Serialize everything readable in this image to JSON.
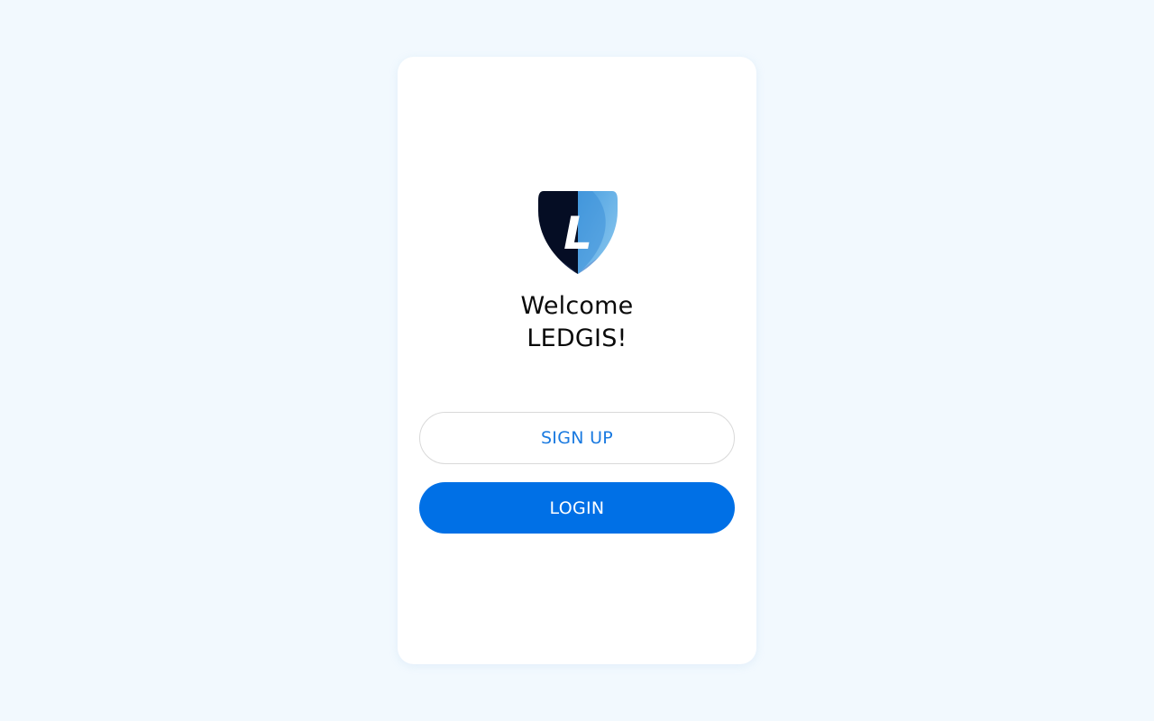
{
  "app": {
    "logo_icon": "shield-l-logo-icon",
    "logo_letter": "L",
    "welcome_line1": "Welcome",
    "welcome_line2": "LEDGIS!"
  },
  "actions": {
    "signup_label": "SIGN UP",
    "login_label": "LOGIN"
  },
  "colors": {
    "background": "#f2f9fe",
    "card": "#ffffff",
    "primary": "#0070e6",
    "primary_text": "#1a7ae0",
    "logo_dark": "#050d24",
    "logo_light": "#5aa9e6"
  }
}
